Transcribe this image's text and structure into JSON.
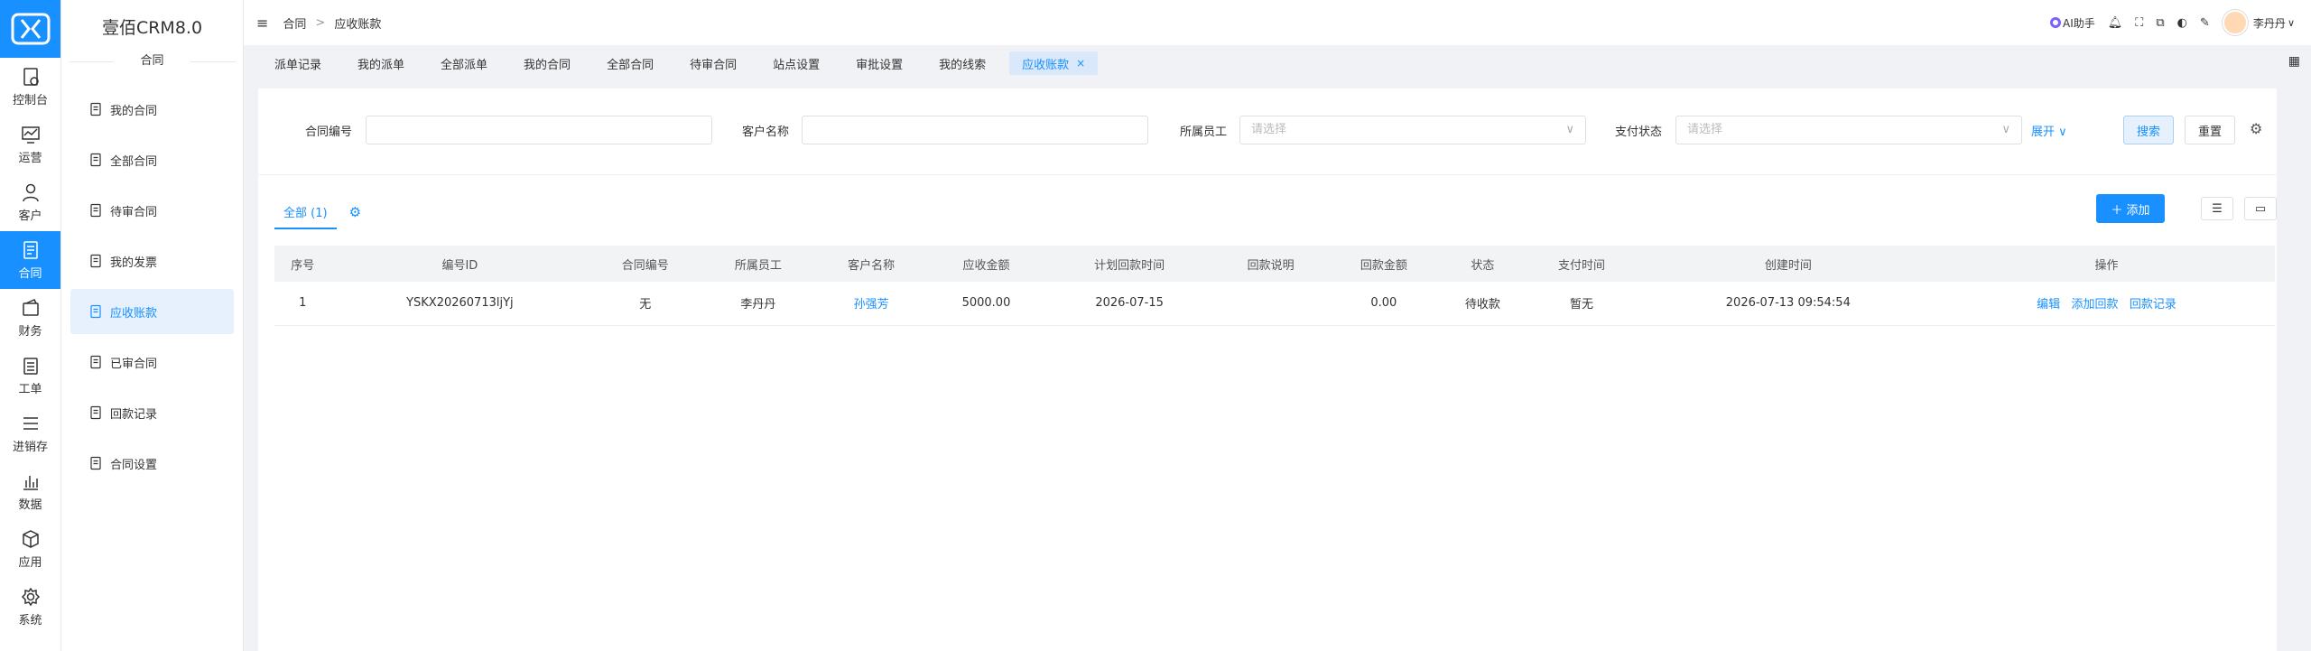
{
  "brand": {
    "app_name": "壹佰CRM8.0",
    "accent": "#1890ff"
  },
  "rail": [
    {
      "label": "控制台",
      "icon": "dashboard-icon"
    },
    {
      "label": "运营",
      "icon": "chart-monitor-icon"
    },
    {
      "label": "客户",
      "icon": "user-icon"
    },
    {
      "label": "合同",
      "icon": "document-icon",
      "active": true
    },
    {
      "label": "财务",
      "icon": "wallet-icon"
    },
    {
      "label": "工单",
      "icon": "clipboard-icon"
    },
    {
      "label": "进销存",
      "icon": "list-icon"
    },
    {
      "label": "数据",
      "icon": "bar-chart-icon"
    },
    {
      "label": "应用",
      "icon": "cube-icon"
    },
    {
      "label": "系统",
      "icon": "settings-icon"
    }
  ],
  "sub": {
    "section": "合同",
    "items": [
      {
        "label": "我的合同"
      },
      {
        "label": "全部合同"
      },
      {
        "label": "待审合同"
      },
      {
        "label": "我的发票"
      },
      {
        "label": "应收账款",
        "active": true
      },
      {
        "label": "已审合同"
      },
      {
        "label": "回款记录"
      },
      {
        "label": "合同设置"
      }
    ]
  },
  "breadcrumb": {
    "first": "合同",
    "sep": ">",
    "current": "应收账款"
  },
  "topbar": {
    "ai_label": "AI助手",
    "user_name": "李丹丹"
  },
  "tabs": [
    {
      "label": "派单记录"
    },
    {
      "label": "我的派单"
    },
    {
      "label": "全部派单"
    },
    {
      "label": "我的合同"
    },
    {
      "label": "全部合同"
    },
    {
      "label": "待审合同"
    },
    {
      "label": "站点设置"
    },
    {
      "label": "审批设置"
    },
    {
      "label": "我的线索"
    },
    {
      "label": "应收账款",
      "active": true,
      "close": "×"
    }
  ],
  "filters": {
    "contract_no_label": "合同编号",
    "contract_no_value": "",
    "customer_label": "客户名称",
    "customer_value": "",
    "employee_label": "所属员工",
    "employee_placeholder": "请选择",
    "pay_status_label": "支付状态",
    "pay_status_placeholder": "请选择",
    "expand": "展开",
    "search_btn": "搜索",
    "reset_btn": "重置"
  },
  "list": {
    "tab_all": "全部 (1)",
    "add_btn": "添加",
    "columns": [
      "序号",
      "编号ID",
      "合同编号",
      "所属员工",
      "客户名称",
      "应收金额",
      "计划回款时间",
      "回款说明",
      "回款金额",
      "状态",
      "支付时间",
      "创建时间",
      "操作"
    ],
    "rows": [
      {
        "no": "1",
        "id": "YSKX20260713ljYj",
        "contract_no": "无",
        "employee": "李丹丹",
        "customer": "孙强芳",
        "amount": "5000.00",
        "plan_date": "2026-07-15",
        "note": "",
        "received": "0.00",
        "status": "待收款",
        "pay_time": "暂无",
        "created": "2026-07-13 09:54:54",
        "actions": {
          "edit": "编辑",
          "add_payment": "添加回款",
          "records": "回款记录"
        }
      }
    ]
  }
}
